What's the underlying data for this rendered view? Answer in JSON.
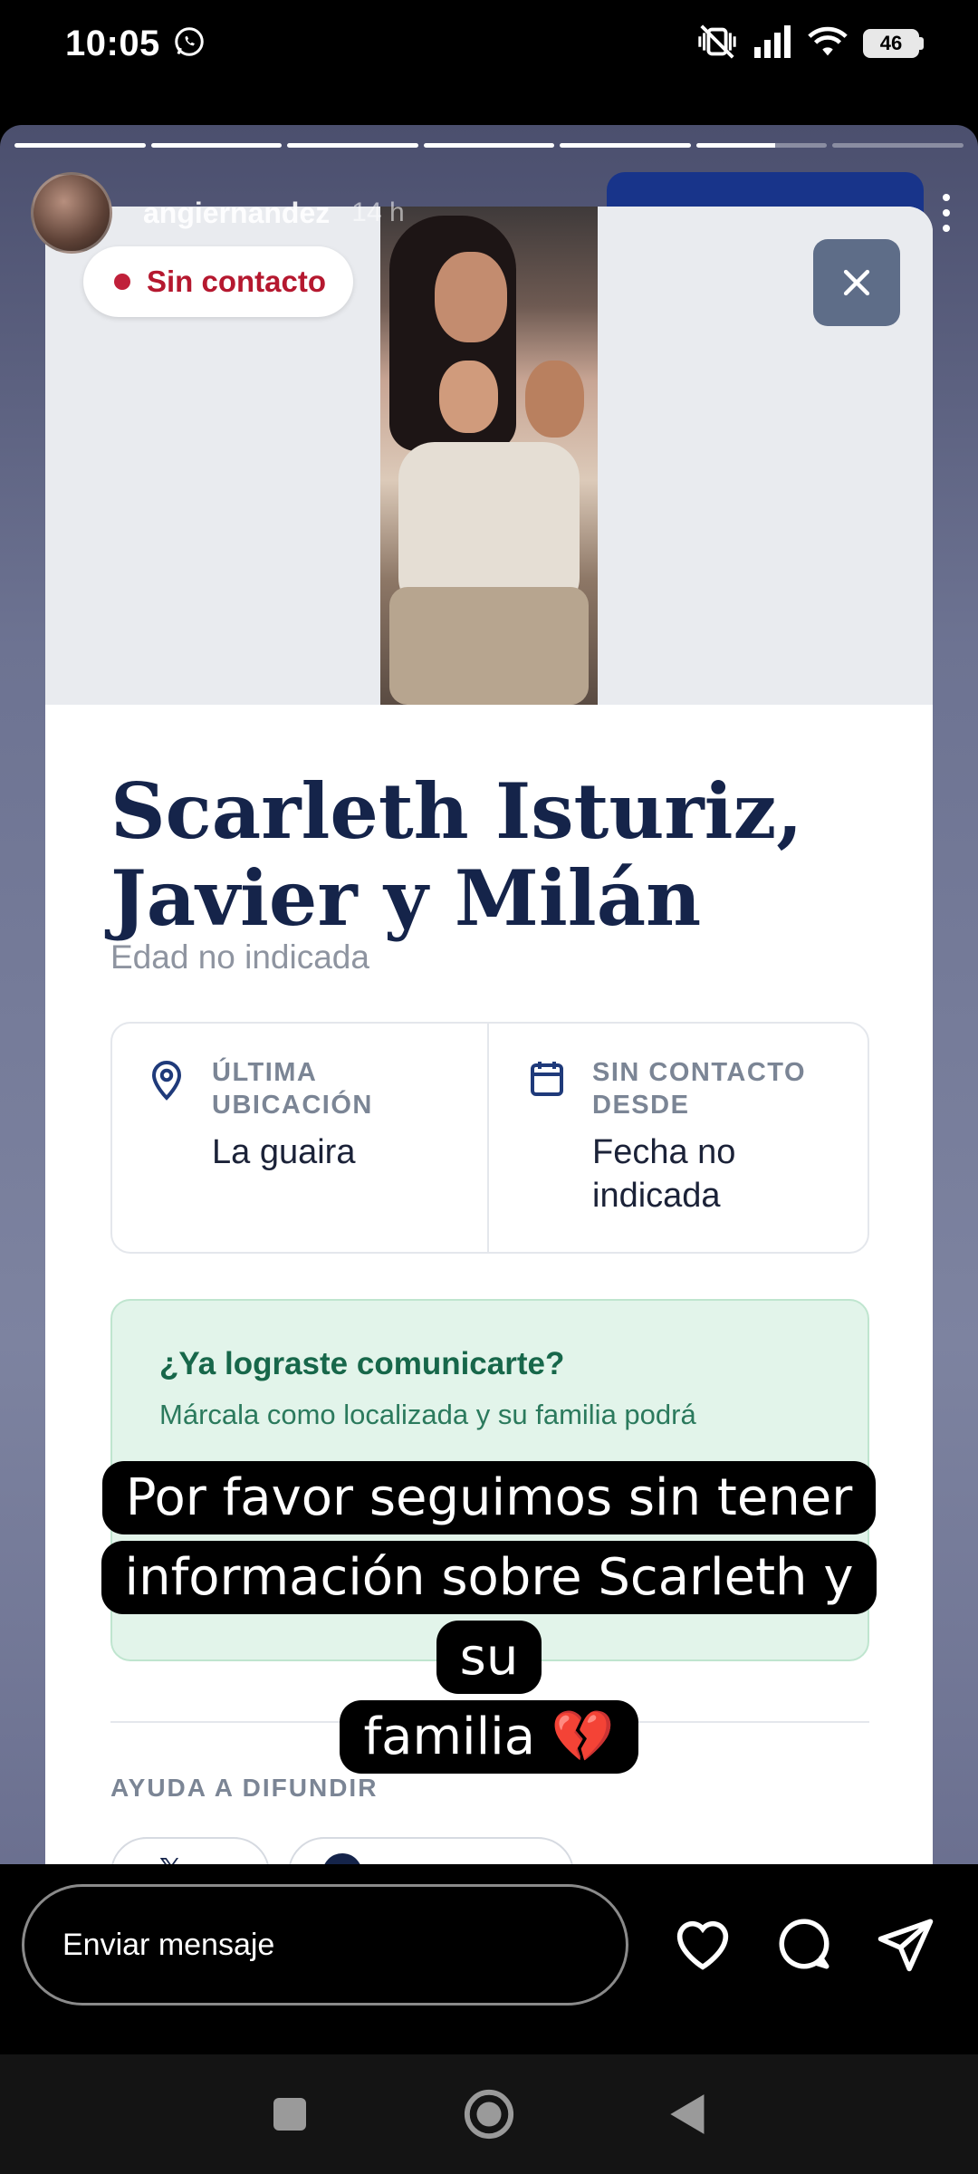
{
  "status_bar": {
    "time": "10:05",
    "battery": "46",
    "icons": [
      "whatsapp-icon",
      "mute-vibrate-icon",
      "signal-icon",
      "wifi-icon",
      "battery-icon"
    ]
  },
  "story": {
    "progress_segments": 7,
    "active_segment_fill": 0.6,
    "username": "angiernandez",
    "time_ago": "14 h"
  },
  "card": {
    "status_badge": "Sin contacto",
    "person_name": "Scarleth Isturiz, Javier y Milán",
    "age": "Edad no indicada",
    "last_location_label": "ÚLTIMA UBICACIÓN",
    "last_location_value": "La guaira",
    "no_contact_since_label": "SIN CONTACTO DESDE",
    "no_contact_since_value": "Fecha no indicada",
    "contact_title": "¿Ya lograste comunicarte?",
    "contact_subtitle": "Márcala como localizada y su familia podrá",
    "share_label": "AYUDA A DIFUNDIR"
  },
  "caption": {
    "line1": "Por favor seguimos sin tener",
    "line2": "información sobre Scarleth y su",
    "line3": "familia 💔"
  },
  "message_bar": {
    "placeholder": "Enviar mensaje"
  },
  "colors": {
    "status_red": "#b5182f",
    "title_navy": "#15244a",
    "green_bg": "#e2f4ea",
    "green_text": "#17674a"
  }
}
